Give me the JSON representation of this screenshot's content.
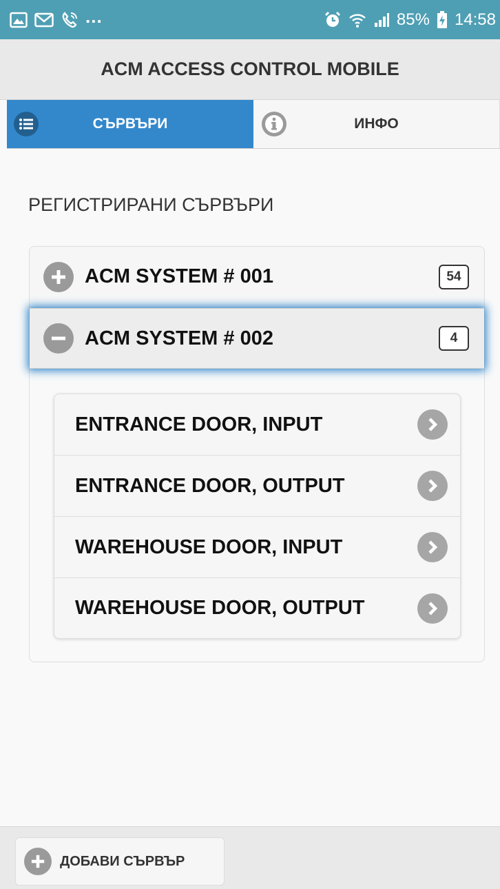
{
  "status_bar": {
    "left_icons": [
      "gallery-icon",
      "gmail-icon",
      "phone-call-icon"
    ],
    "more": "...",
    "right_icons": [
      "alarm-icon",
      "wifi-icon",
      "signal-icon"
    ],
    "battery": "85%",
    "time": "14:58"
  },
  "header": {
    "title": "ACM ACCESS CONTROL MOBILE"
  },
  "tabs": [
    {
      "label": "СЪРВЪРИ",
      "icon": "list-icon",
      "active": true
    },
    {
      "label": "ИНФО",
      "icon": "info-icon",
      "active": false
    }
  ],
  "section": {
    "title": "РЕГИСТРИРАНИ СЪРВЪРИ"
  },
  "servers": [
    {
      "name": "ACM SYSTEM # 001",
      "count": "54",
      "icon": "plus-icon",
      "expanded": false
    },
    {
      "name": "ACM SYSTEM # 002",
      "count": "4",
      "icon": "minus-icon",
      "expanded": true
    }
  ],
  "doors": [
    {
      "label": "ENTRANCE DOOR, INPUT"
    },
    {
      "label": "ENTRANCE DOOR, OUTPUT"
    },
    {
      "label": "WAREHOUSE DOOR, INPUT"
    },
    {
      "label": "WAREHOUSE DOOR, OUTPUT"
    }
  ],
  "footer": {
    "add_label": "ДОБАВИ СЪРВЪР"
  },
  "colors": {
    "status_bar": "#4f9fb4",
    "accent": "#3388cc",
    "icon_gray": "#9a9a9a"
  }
}
